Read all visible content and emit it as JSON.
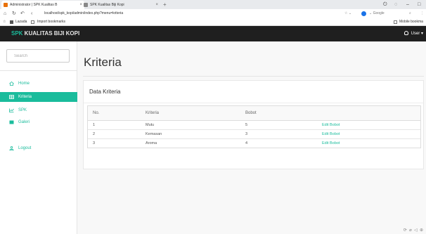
{
  "browser": {
    "tabs": [
      {
        "title": "Administrator | SPK Kualitas B",
        "active": true
      },
      {
        "title": "SPK Kualitas Biji Kopi",
        "active": false
      }
    ],
    "new_tab": "+",
    "url": "localhost/spk_kopi/admin/index.php?menu=kriteria",
    "search_engine": "Google",
    "bookmarks": [
      {
        "label": "Lazada"
      },
      {
        "label": "Import bookmarks"
      }
    ],
    "mobile_bookmarks": "Mobile bookma"
  },
  "header": {
    "brand_accent": "SPK",
    "brand_rest": " KUALITAS BIJI KOPI",
    "user_label": "User ▾"
  },
  "sidebar": {
    "search_placeholder": "Search",
    "items": [
      {
        "label": "Home",
        "icon": "home-icon",
        "active": false
      },
      {
        "label": "Kriteria",
        "icon": "table-icon",
        "active": true
      },
      {
        "label": "SPK",
        "icon": "chart-icon",
        "active": false
      },
      {
        "label": "Galeri",
        "icon": "gallery-icon",
        "active": false
      },
      {
        "label": "Logout",
        "icon": "user-icon",
        "active": false
      }
    ]
  },
  "main": {
    "title": "Kriteria",
    "panel_heading": "Data Kriteria",
    "table": {
      "headers": [
        "No.",
        "Kriteria",
        "Bobot",
        ""
      ],
      "rows": [
        [
          "1",
          "Mutu",
          "5",
          "Edit Bobot"
        ],
        [
          "2",
          "Kemasan",
          "3",
          "Edit Bobot"
        ],
        [
          "3",
          "Aroma",
          "4",
          "Edit Bobot"
        ]
      ]
    }
  },
  "colors": {
    "accent": "#1abc9c",
    "header_bg": "#1f1f1f"
  }
}
